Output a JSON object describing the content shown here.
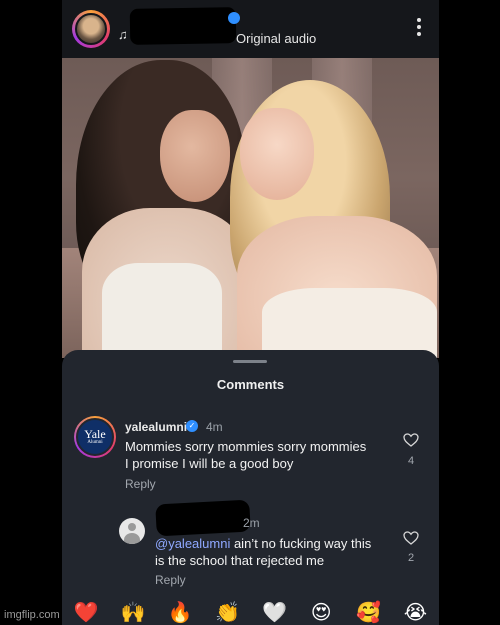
{
  "header": {
    "audio_label": "Original audio",
    "music_icon": "music-note-icon",
    "more_icon": "more-vertical-icon"
  },
  "comments_panel": {
    "title": "Comments",
    "comments": [
      {
        "username": "yalealumni",
        "verified": true,
        "time": "4m",
        "avatar_text": [
          "Yale",
          "Alumni"
        ],
        "text_lines": [
          "Mommies sorry mommies sorry mommies",
          "I promise I will be a good boy"
        ],
        "reply_label": "Reply",
        "likes": "4"
      },
      {
        "username": "",
        "time": "2m",
        "mention": "@yalealumni",
        "text_line1_rest": " ain’t no fucking way this",
        "text_line2": "is the school that rejected me",
        "reply_label": "Reply",
        "likes": "2"
      }
    ]
  },
  "emoji_bar": [
    "❤️",
    "🙌",
    "🔥",
    "👏",
    "🤍",
    "😍",
    "🥰",
    "😭"
  ],
  "watermark": "imgflip.com",
  "colors": {
    "sheet_bg": "#22262e",
    "mention": "#8fa8ff",
    "verified": "#2f8fff"
  }
}
